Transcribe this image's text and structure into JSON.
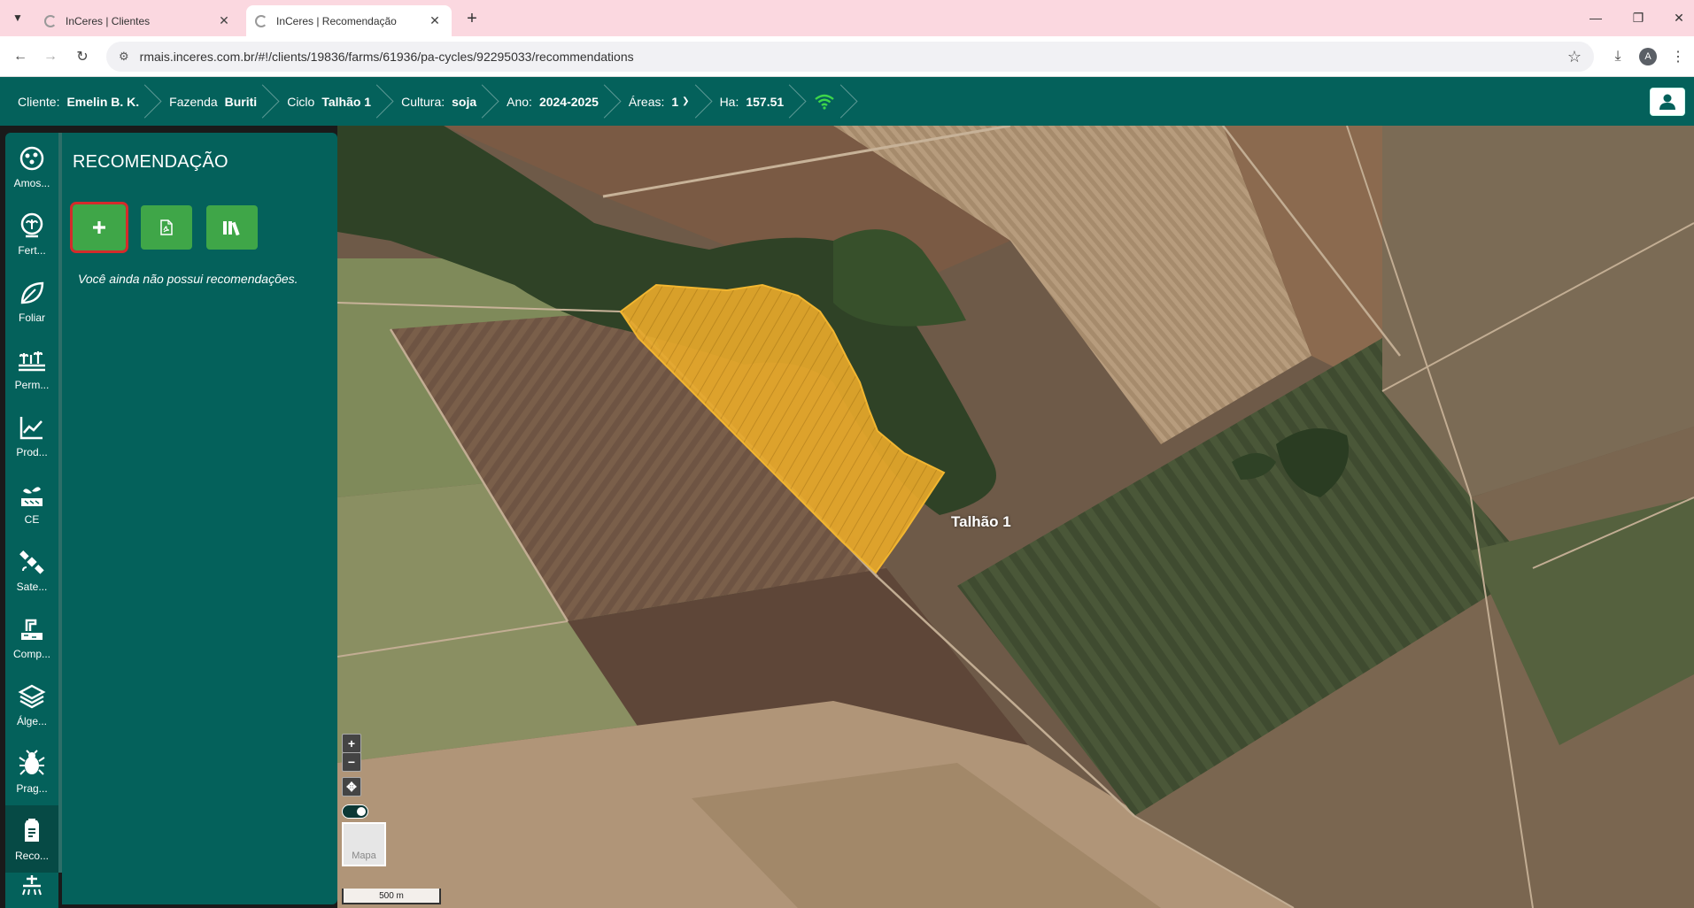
{
  "browser": {
    "tabs": [
      {
        "title": "InCeres | Clientes"
      },
      {
        "title": "InCeres | Recomendação"
      }
    ],
    "url": "rmais.inceres.com.br/#!/clients/19836/farms/61936/pa-cycles/92295033/recommendations",
    "profile_initial": "A"
  },
  "header": {
    "client_label": "Cliente:",
    "client_value": "Emelin B. K.",
    "farm_label": "Fazenda",
    "farm_value": "Buriti",
    "cycle_label": "Ciclo",
    "cycle_value": "Talhão 1",
    "culture_label": "Cultura:",
    "culture_value": "soja",
    "year_label": "Ano:",
    "year_value": "2024-2025",
    "areas_label": "Áreas:",
    "areas_value": "1",
    "ha_label": "Ha:",
    "ha_value": "157.51"
  },
  "rail": {
    "items": [
      {
        "label": "Amos...",
        "icon": "sampling-icon"
      },
      {
        "label": "Fert...",
        "icon": "fertility-icon"
      },
      {
        "label": "Foliar",
        "icon": "leaf-icon"
      },
      {
        "label": "Perm...",
        "icon": "permanent-crop-icon"
      },
      {
        "label": "Prod...",
        "icon": "productivity-chart-icon"
      },
      {
        "label": "CE",
        "icon": "ce-sprout-icon"
      },
      {
        "label": "Sate...",
        "icon": "satellite-icon"
      },
      {
        "label": "Comp...",
        "icon": "compaction-icon"
      },
      {
        "label": "Álge...",
        "icon": "layers-icon"
      },
      {
        "label": "Prag...",
        "icon": "bug-icon"
      },
      {
        "label": "Reco...",
        "icon": "recommendation-icon"
      }
    ]
  },
  "panel": {
    "title": "RECOMENDAÇÃO",
    "empty_message": "Você ainda não possui recomendações."
  },
  "map": {
    "field_label": "Talhão 1",
    "basemap_label": "Mapa",
    "scale_label": "500 m",
    "field_color": "#e6a82a"
  }
}
